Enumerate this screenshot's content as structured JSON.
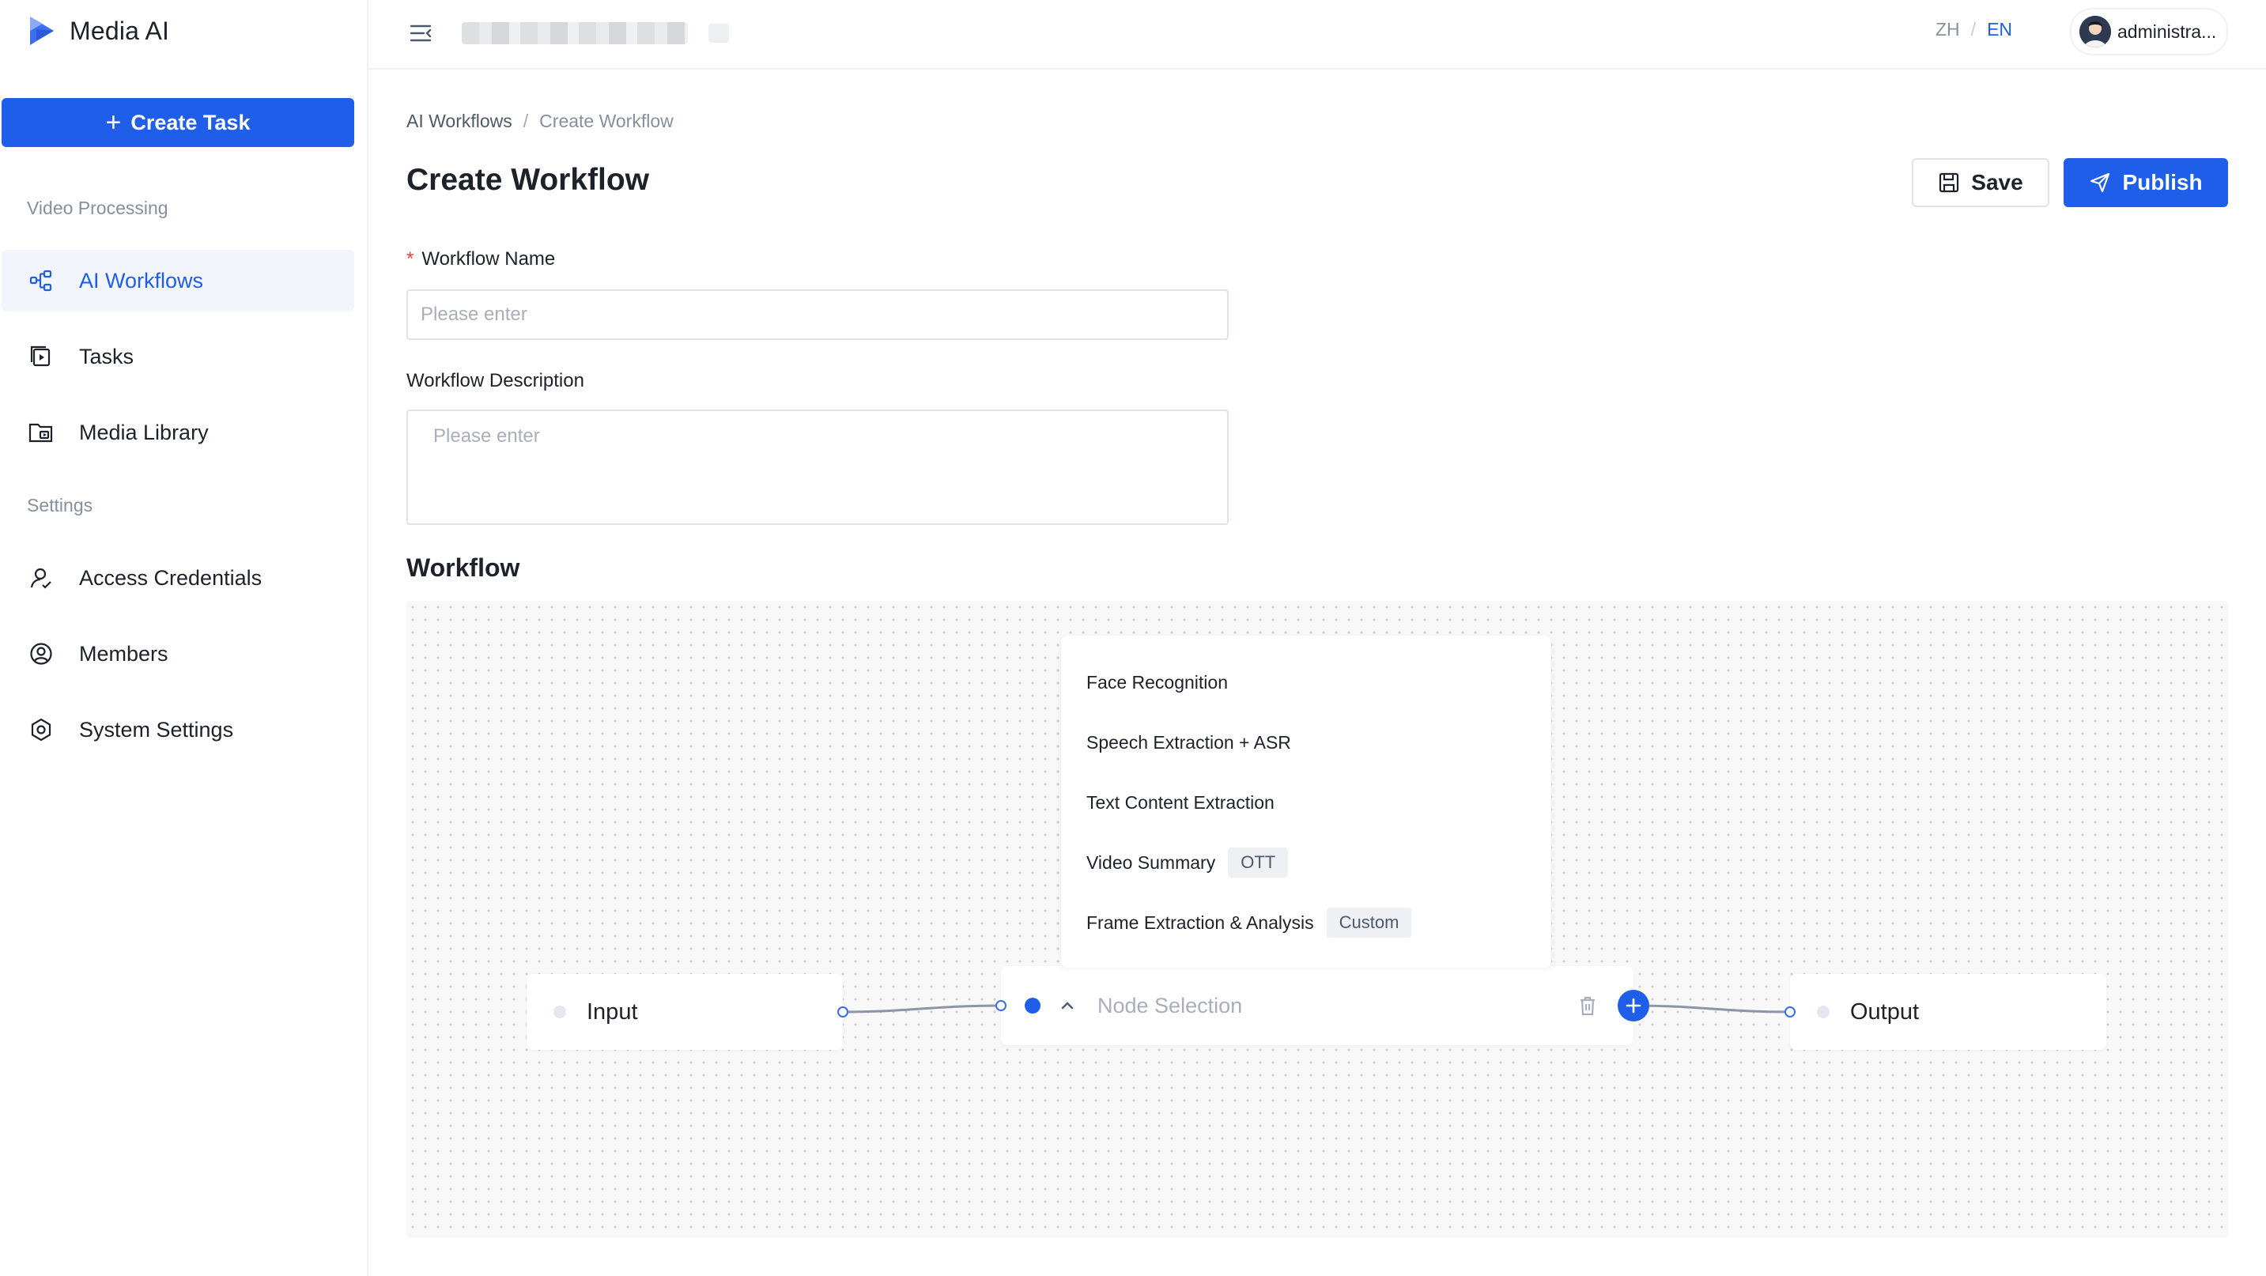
{
  "app": {
    "name": "Media AI"
  },
  "sidebar": {
    "create_task_label": "Create Task",
    "section_video": "Video Processing",
    "section_settings": "Settings",
    "items": [
      {
        "label": "AI Workflows",
        "icon": "workflow-icon",
        "active": true
      },
      {
        "label": "Tasks",
        "icon": "tasks-icon"
      },
      {
        "label": "Media Library",
        "icon": "media-library-icon"
      },
      {
        "label": "Access Credentials",
        "icon": "credentials-icon"
      },
      {
        "label": "Members",
        "icon": "members-icon"
      },
      {
        "label": "System Settings",
        "icon": "settings-icon"
      }
    ]
  },
  "header": {
    "lang_zh": "ZH",
    "lang_sep": "/",
    "lang_en": "EN",
    "lang_active": "EN",
    "user_name": "administra..."
  },
  "breadcrumb": {
    "parent": "AI Workflows",
    "sep": "/",
    "current": "Create Workflow"
  },
  "page": {
    "title": "Create Workflow",
    "save_label": "Save",
    "publish_label": "Publish"
  },
  "form": {
    "name_label": "Workflow Name",
    "name_required": "*",
    "name_placeholder": "Please enter",
    "name_value": "",
    "desc_label": "Workflow Description",
    "desc_placeholder": "Please enter",
    "desc_value": ""
  },
  "workflow": {
    "section_title": "Workflow",
    "input_node": "Input",
    "selection_placeholder": "Node Selection",
    "output_node": "Output",
    "options": [
      {
        "label": "Face Recognition",
        "tag": ""
      },
      {
        "label": "Speech Extraction + ASR",
        "tag": ""
      },
      {
        "label": "Text Content Extraction",
        "tag": ""
      },
      {
        "label": "Video Summary",
        "tag": "OTT"
      },
      {
        "label": "Frame Extraction & Analysis",
        "tag": "Custom"
      }
    ]
  },
  "colors": {
    "accent": "#1f5ee8",
    "required": "#f53f3f",
    "canvas_bg": "#f8f8f9"
  }
}
